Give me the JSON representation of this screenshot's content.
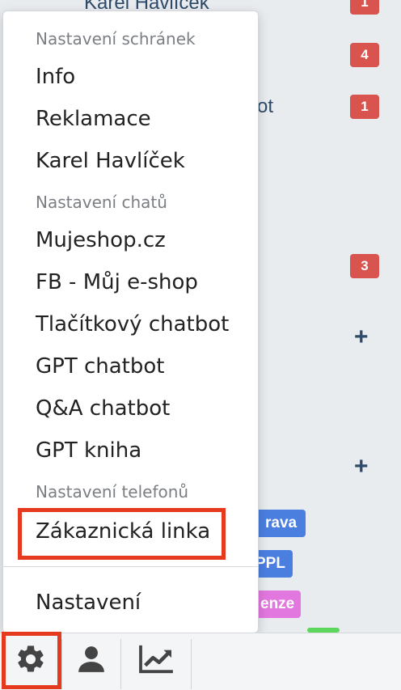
{
  "background": {
    "row_1": "Karel Havlíček",
    "row_ot": "ot",
    "badges": [
      "1",
      "4",
      "1",
      "3"
    ],
    "plus": "+",
    "tags": [
      {
        "label": "rava",
        "color": "#4a7fe0"
      },
      {
        "label": "PPL",
        "color": "#4a7fe0"
      },
      {
        "label": "enze",
        "color": "#e377e0"
      }
    ]
  },
  "menu": {
    "header_mailboxes": "Nastavení schránek",
    "item_info": "Info",
    "item_reklamace": "Reklamace",
    "item_karel": "Karel Havlíček",
    "header_chats": "Nastavení chatů",
    "item_mujeshop": "Mujeshop.cz",
    "item_fb": "FB - Můj e-shop",
    "item_button_chatbot": "Tlačítkový chatbot",
    "item_gpt_chatbot": "GPT chatbot",
    "item_qa_chatbot": "Q&A chatbot",
    "item_gpt_kniha": "GPT kniha",
    "header_phones": "Nastavení telefonů",
    "item_zakaznicka": "Zákaznická linka",
    "item_nastaveni": "Nastavení"
  },
  "toolbar": {
    "icons": [
      "gear-icon",
      "user-icon",
      "chart-icon"
    ]
  },
  "colors": {
    "highlight": "#e63a1f",
    "badge": "#d9534f",
    "text_dark": "#2d4a6b"
  }
}
